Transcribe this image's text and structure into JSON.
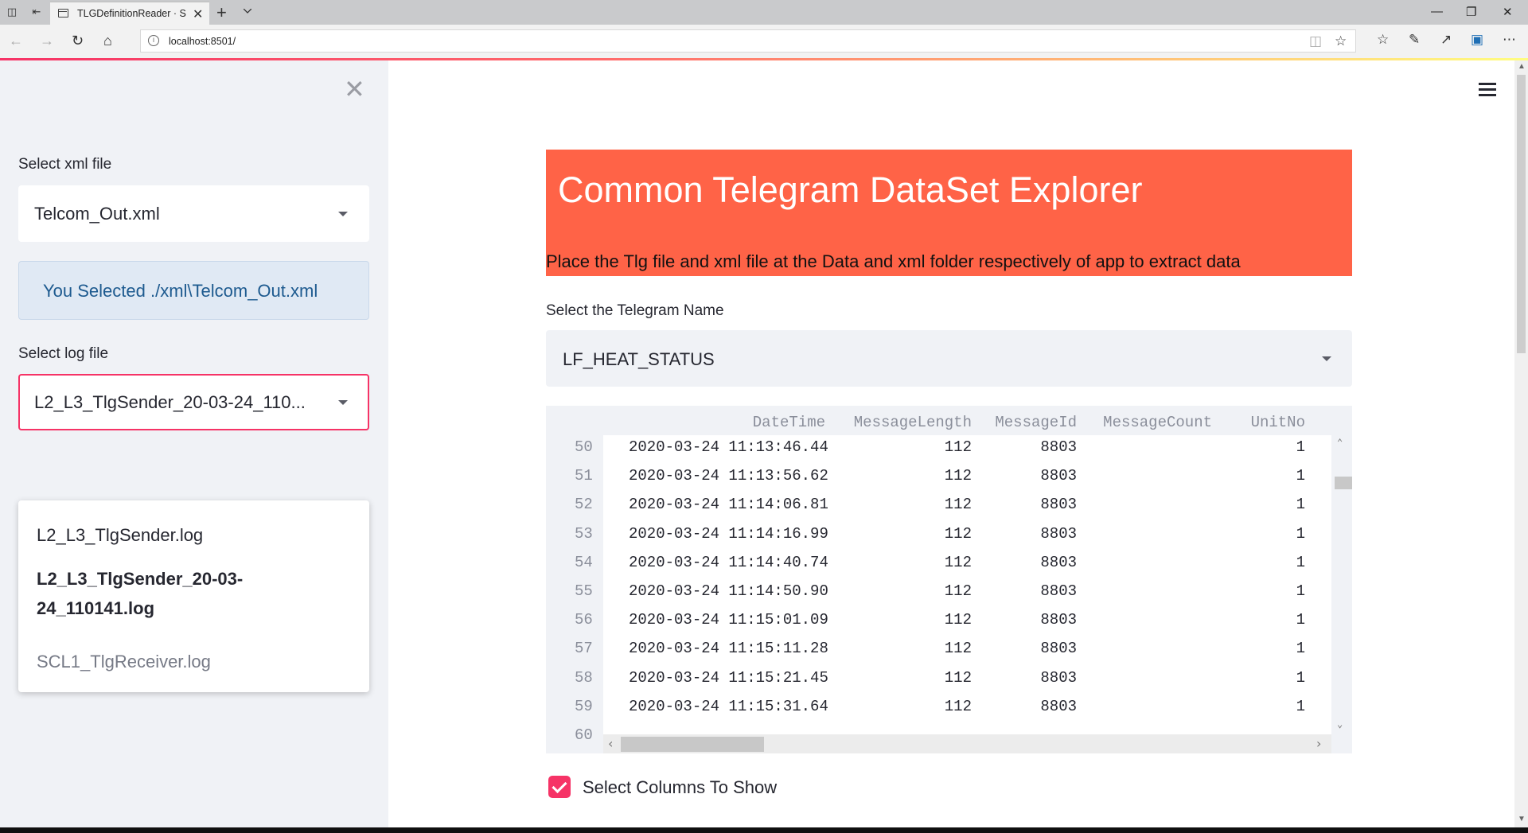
{
  "browser": {
    "tab_title": "TLGDefinitionReader · S",
    "url": "localhost:8501/",
    "new_tab": "+",
    "tab_close": "✕"
  },
  "sidebar": {
    "close": "✕",
    "xml_label": "Select xml file",
    "xml_value": "Telcom_Out.xml",
    "info_text": "You Selected ./xml\\Telcom_Out.xml",
    "log_label": "Select log file",
    "log_value": "L2_L3_TlgSender_20-03-24_110...",
    "log_options": [
      "L2_L3_TlgSender.log",
      "L2_L3_TlgSender_20-03-24_110141.log",
      "SCL1_TlgReceiver.log"
    ]
  },
  "main": {
    "title": "Common Telegram DataSet Explorer",
    "subtitle": "Place the Tlg file and xml file at the Data and xml folder respectively of app to extract data",
    "telegram_label": "Select the Telegram Name",
    "telegram_value": "LF_HEAT_STATUS",
    "checkbox_label": "Select Columns To Show",
    "checkbox_checked": true
  },
  "table": {
    "columns": [
      "DateTime",
      "MessageLength",
      "MessageId",
      "MessageCount",
      "UnitNo"
    ],
    "rows": [
      {
        "idx": "50",
        "DateTime": "2020-03-24 11:13:46.44",
        "MessageLength": "112",
        "MessageId": "8803",
        "MessageCount": "",
        "UnitNo": "1"
      },
      {
        "idx": "51",
        "DateTime": "2020-03-24 11:13:56.62",
        "MessageLength": "112",
        "MessageId": "8803",
        "MessageCount": "",
        "UnitNo": "1"
      },
      {
        "idx": "52",
        "DateTime": "2020-03-24 11:14:06.81",
        "MessageLength": "112",
        "MessageId": "8803",
        "MessageCount": "",
        "UnitNo": "1"
      },
      {
        "idx": "53",
        "DateTime": "2020-03-24 11:14:16.99",
        "MessageLength": "112",
        "MessageId": "8803",
        "MessageCount": "",
        "UnitNo": "1"
      },
      {
        "idx": "54",
        "DateTime": "2020-03-24 11:14:40.74",
        "MessageLength": "112",
        "MessageId": "8803",
        "MessageCount": "",
        "UnitNo": "1"
      },
      {
        "idx": "55",
        "DateTime": "2020-03-24 11:14:50.90",
        "MessageLength": "112",
        "MessageId": "8803",
        "MessageCount": "",
        "UnitNo": "1"
      },
      {
        "idx": "56",
        "DateTime": "2020-03-24 11:15:01.09",
        "MessageLength": "112",
        "MessageId": "8803",
        "MessageCount": "",
        "UnitNo": "1"
      },
      {
        "idx": "57",
        "DateTime": "2020-03-24 11:15:11.28",
        "MessageLength": "112",
        "MessageId": "8803",
        "MessageCount": "",
        "UnitNo": "1"
      },
      {
        "idx": "58",
        "DateTime": "2020-03-24 11:15:21.45",
        "MessageLength": "112",
        "MessageId": "8803",
        "MessageCount": "",
        "UnitNo": "1"
      },
      {
        "idx": "59",
        "DateTime": "2020-03-24 11:15:31.64",
        "MessageLength": "112",
        "MessageId": "8803",
        "MessageCount": "",
        "UnitNo": "1"
      },
      {
        "idx": "60",
        "DateTime": "",
        "MessageLength": "",
        "MessageId": "",
        "MessageCount": "",
        "UnitNo": ""
      }
    ]
  },
  "colors": {
    "accent": "#f63366",
    "banner": "#ff6347",
    "sidebar_bg": "#f0f2f6",
    "info_bg": "#e0e9f4",
    "info_text": "#1d5a8f"
  },
  "icons": {
    "back": "back-arrow-icon",
    "forward": "forward-arrow-icon",
    "refresh": "refresh-icon",
    "home": "home-icon",
    "favorite": "star-icon",
    "menu": "hamburger-menu-icon"
  }
}
